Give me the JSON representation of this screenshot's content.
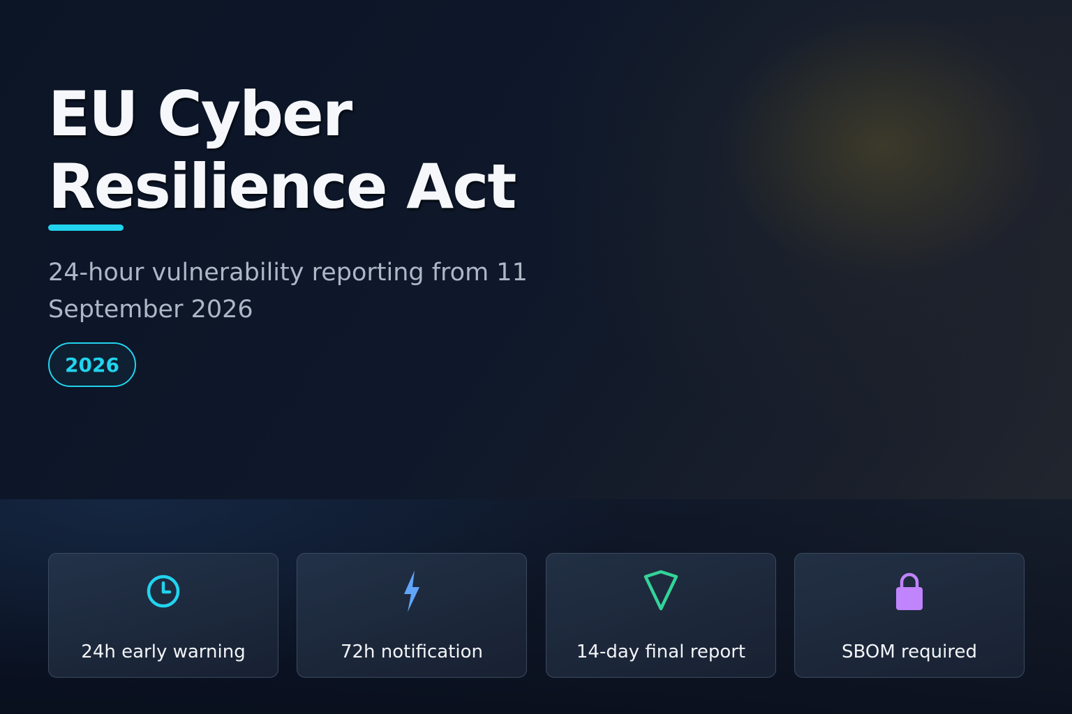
{
  "hero": {
    "title_line1": "EU Cyber",
    "title_line2": "Resilience Act",
    "subtitle": "24-hour vulnerability reporting from 11 September 2026",
    "badge": "2026"
  },
  "cards": [
    {
      "label": "24h early warning",
      "icon": "clock-icon",
      "color": "#22d3ee"
    },
    {
      "label": "72h notification",
      "icon": "lightning-icon",
      "color": "#60a5fa"
    },
    {
      "label": "14-day final report",
      "icon": "shield-icon",
      "color": "#34d399"
    },
    {
      "label": "SBOM required",
      "icon": "lock-icon",
      "color": "#c084fc"
    }
  ],
  "colors": {
    "accent": "#22d3ee",
    "background": "#0b1526"
  }
}
